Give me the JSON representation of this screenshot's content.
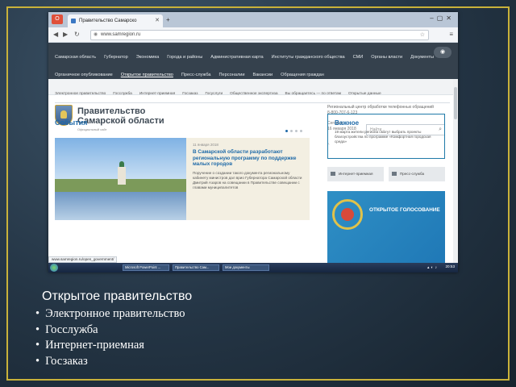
{
  "browser": {
    "tab_title": "Правительство Самарско",
    "url": "www.samregion.ru",
    "status_url": "www.samregion.ru/open_government/"
  },
  "site": {
    "topnav_row1": [
      "Самарская область",
      "Губернатор",
      "Экономика",
      "Города и районы",
      "Административная карта",
      "Институты гражданского общества",
      "СМИ",
      "Органы власти",
      "Документы"
    ],
    "topnav_row2": [
      "Органичное опубликование",
      "Открытое правительство",
      "Пресс-служба",
      "Персоналии",
      "Вакансии",
      "Обращения граждан"
    ],
    "topnav_active_index": 1,
    "subnav": [
      "Электронное правительство",
      "Госслужба",
      "Интернет-приемная",
      "Госзаказ",
      "Госуслуги",
      "Общественное экспертиза",
      "Вы обращаетесь — по ответам",
      "Открытые данные"
    ],
    "title": "Правительство Самарской области",
    "title_sub": "Официальный сайт",
    "hotline_label": "Региональный центр обработки телефонных обращений",
    "hotline_number": "8-800-707-6-123",
    "today_label": "Сегодня",
    "today_date": "16 января 2018",
    "search_placeholder": "Найти..."
  },
  "events": {
    "title": "События",
    "date": "11 января 2018",
    "headline": "В Самарской области разработают региональную программу по поддержке малых городов",
    "text": "Поручение о создании такого документа региональному кабинету министров дал врио Губернатора Самарской области Дмитрий Азаров на совещании в Правительстве совещании с главами муниципалитетов"
  },
  "sidebar": {
    "important_title": "Важное",
    "important_text": "19 марта жители региона смогут выбрать проекты благоустройства по программе «Комфортная городская среда»",
    "btn_internet": "Интернет-приемная",
    "btn_press": "Пресс-служба",
    "banner_text": "ОТКРЫТОЕ ГОЛОСОВАНИЕ"
  },
  "taskbar": {
    "tasks": [
      "Microsoft PowerPoint ...",
      "Правительство Сам...",
      "Мои документы"
    ],
    "clock": "20:53"
  },
  "slide": {
    "heading": "Открытое правительство",
    "bullets": [
      "Электронное правительство",
      "Госслужба",
      "Интернет-приемная",
      "Госзаказ"
    ]
  }
}
